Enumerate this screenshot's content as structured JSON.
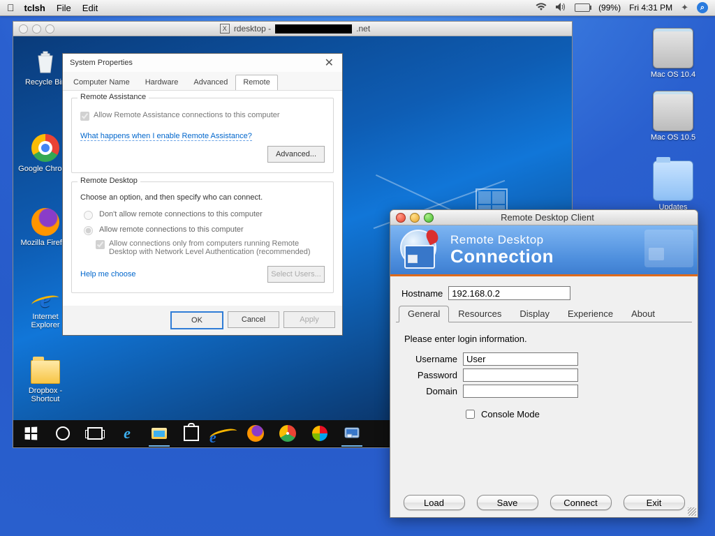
{
  "mac_menubar": {
    "app": "tclsh",
    "menus": [
      "File",
      "Edit"
    ],
    "battery_pct": "(99%)",
    "clock": "Fri 4:31 PM"
  },
  "mac_desktop_icons": {
    "drive1": "Mac OS 10.4",
    "drive2": "Mac OS 10.5",
    "folder": "Updates"
  },
  "rdesktop": {
    "title_prefix": "rdesktop - ",
    "title_suffix": ".net"
  },
  "win_icons": {
    "recycle": "Recycle Bin",
    "chrome": "Google Chrome",
    "firefox": "Mozilla Firefox",
    "ie": "Internet Explorer",
    "dropbox": "Dropbox - Shortcut"
  },
  "sysprops": {
    "title": "System Properties",
    "tabs": [
      "Computer Name",
      "Hardware",
      "Advanced",
      "Remote"
    ],
    "ra_legend": "Remote Assistance",
    "ra_allow": "Allow Remote Assistance connections to this computer",
    "ra_link": "What happens when I enable Remote Assistance?",
    "ra_adv": "Advanced...",
    "rd_legend": "Remote Desktop",
    "rd_intro": "Choose an option, and then specify who can connect.",
    "rd_opt1": "Don't allow remote connections to this computer",
    "rd_opt2": "Allow remote connections to this computer",
    "rd_nla": "Allow connections only from computers running Remote Desktop with Network Level Authentication (recommended)",
    "rd_help": "Help me choose",
    "rd_select": "Select Users...",
    "ok": "OK",
    "cancel": "Cancel",
    "apply": "Apply"
  },
  "rdc": {
    "title": "Remote Desktop Client",
    "banner1": "Remote Desktop",
    "banner2": "Connection",
    "host_label": "Hostname",
    "host_value": "192.168.0.2",
    "tabs": [
      "General",
      "Resources",
      "Display",
      "Experience",
      "About"
    ],
    "prompt": "Please enter login information.",
    "user_label": "Username",
    "user_value": "User",
    "pass_label": "Password",
    "pass_value": "",
    "domain_label": "Domain",
    "domain_value": "",
    "console": "Console Mode",
    "load": "Load",
    "save": "Save",
    "connect": "Connect",
    "exit": "Exit"
  }
}
